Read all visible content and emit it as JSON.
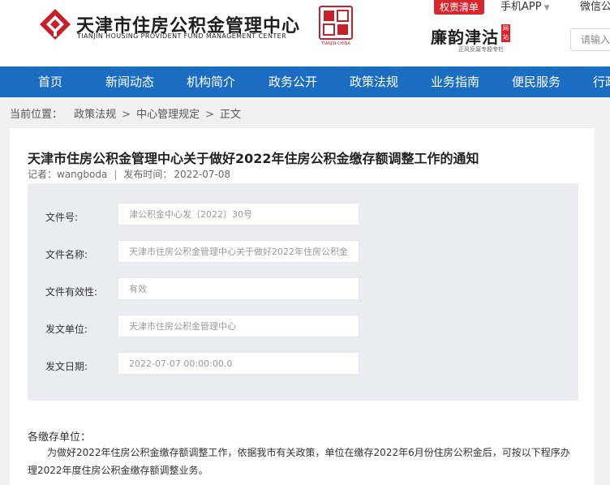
{
  "header": {
    "logo_cn": "天津市住房公积金管理中心",
    "logo_en": "TIANJIN HOUSING PROVIDENT FUND MANAGEMENT CENTER",
    "seal_caption": "TIANJIN·CHINA",
    "quan_btn": "权责清单",
    "mobile_app": "手机APP",
    "weixin": "微信公",
    "lian_cn": "廉韵津沽",
    "lian_tag": "网站",
    "lian_sub": "正风反腐专题专栏",
    "search_placeholder": "请输入",
    "brand_blue": "#1a6dc0",
    "accent_red": "#d8262e"
  },
  "nav": {
    "items": [
      {
        "label": "首页"
      },
      {
        "label": "新闻动态"
      },
      {
        "label": "机构简介"
      },
      {
        "label": "政务公开"
      },
      {
        "label": "政策法规"
      },
      {
        "label": "业务指南"
      },
      {
        "label": "便民服务"
      },
      {
        "label": "行政"
      }
    ]
  },
  "breadcrumb": {
    "prefix": "当前位置：",
    "items": [
      "政策法规",
      "中心管理规定",
      "正文"
    ],
    "separator": ">"
  },
  "article": {
    "title": "天津市住房公积金管理中心关于做好2022年住房公积金缴存额调整工作的通知",
    "author_label": "记者：",
    "author": "wangboda",
    "date_label": "发布时间：",
    "date": "2022-07-08",
    "info_rows": [
      {
        "label": "文件号:",
        "value": "津公积金中心发〔2022〕30号"
      },
      {
        "label": "文件名称:",
        "value": "天津市住房公积金管理中心关于做好2022年住房公积金"
      },
      {
        "label": "文件有效性:",
        "value": "有效"
      },
      {
        "label": "发文单位:",
        "value": "天津市住房公积金管理中心"
      },
      {
        "label": "发文日期:",
        "value": "2022-07-07 00:00:00.0"
      }
    ],
    "salutation": "各缴存单位：",
    "paragraph": "为做好2022年住房公积金缴存额调整工作，依据我市有关政策，单位在缴存2022年6月份住房公积金后，可按以下程序办理2022年度住房公积金缴存额调整业务。"
  }
}
